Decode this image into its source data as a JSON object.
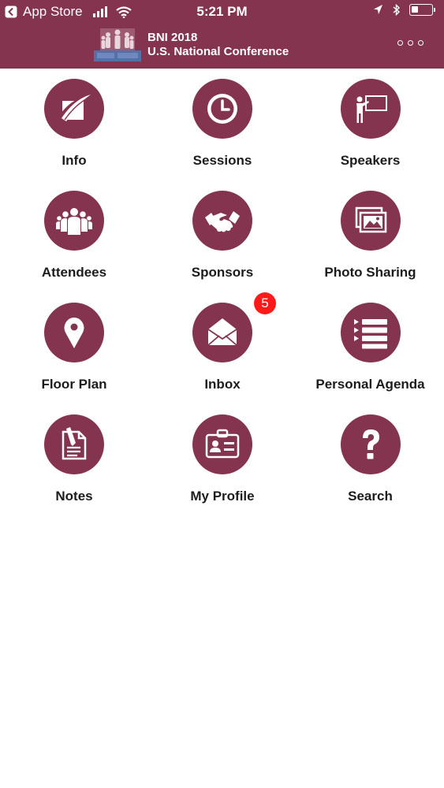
{
  "status_bar": {
    "back_label": "App Store",
    "time": "5:21 PM"
  },
  "header": {
    "title_line1": "BNI 2018",
    "title_line2": "U.S. National Conference"
  },
  "colors": {
    "brand": "#85344f",
    "badge": "#ff1a1a",
    "label": "#1c1c1c"
  },
  "menu": [
    {
      "label": "Info",
      "icon": "info-icon"
    },
    {
      "label": "Sessions",
      "icon": "clock-icon"
    },
    {
      "label": "Speakers",
      "icon": "presenter-icon"
    },
    {
      "label": "Attendees",
      "icon": "people-icon"
    },
    {
      "label": "Sponsors",
      "icon": "handshake-icon"
    },
    {
      "label": "Photo Sharing",
      "icon": "photos-icon"
    },
    {
      "label": "Floor Plan",
      "icon": "map-pin-icon"
    },
    {
      "label": "Inbox",
      "icon": "envelope-icon",
      "badge": "5"
    },
    {
      "label": "Personal Agenda",
      "icon": "list-icon"
    },
    {
      "label": "Notes",
      "icon": "notes-icon"
    },
    {
      "label": "My Profile",
      "icon": "id-card-icon"
    },
    {
      "label": "Search",
      "icon": "question-icon"
    }
  ]
}
